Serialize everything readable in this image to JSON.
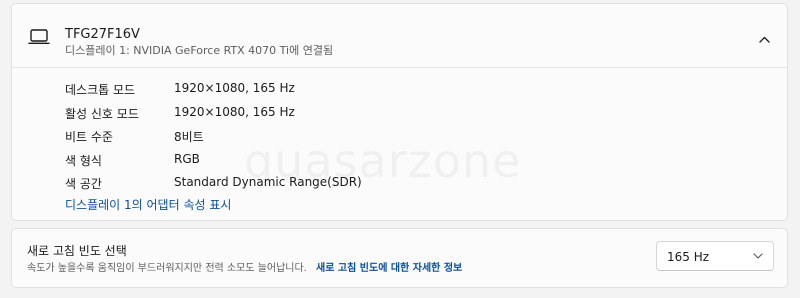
{
  "display": {
    "monitor_name": "TFG27F16V",
    "connection": "디스플레이 1: NVIDIA GeForce RTX 4070 Ti에 연결됨",
    "monitor_icon": "monitor-icon",
    "collapse_icon": "chevron-up-icon",
    "info": [
      {
        "label": "데스크톱 모드",
        "value": "1920×1080, 165 Hz"
      },
      {
        "label": "활성 신호 모드",
        "value": "1920×1080, 165 Hz"
      },
      {
        "label": "비트 수준",
        "value": "8비트"
      },
      {
        "label": "색 형식",
        "value": "RGB"
      },
      {
        "label": "색 공간",
        "value": "Standard Dynamic Range(SDR)"
      }
    ],
    "adapter_link": "디스플레이 1의 어댑터 속성 표시"
  },
  "refresh": {
    "title": "새로 고침 빈도 선택",
    "description": "속도가 높을수록 움직임이 부드러워지지만 전력 소모도 늘어납니다.",
    "more_link": "새로 고침 빈도에 대한 자세한 정보",
    "selected": "165 Hz",
    "dropdown_icon": "chevron-down-icon"
  },
  "watermark": "quasarzone",
  "colors": {
    "link": "#0a4f9c",
    "card": "#fbfbfb",
    "background": "#f3f3f3"
  }
}
